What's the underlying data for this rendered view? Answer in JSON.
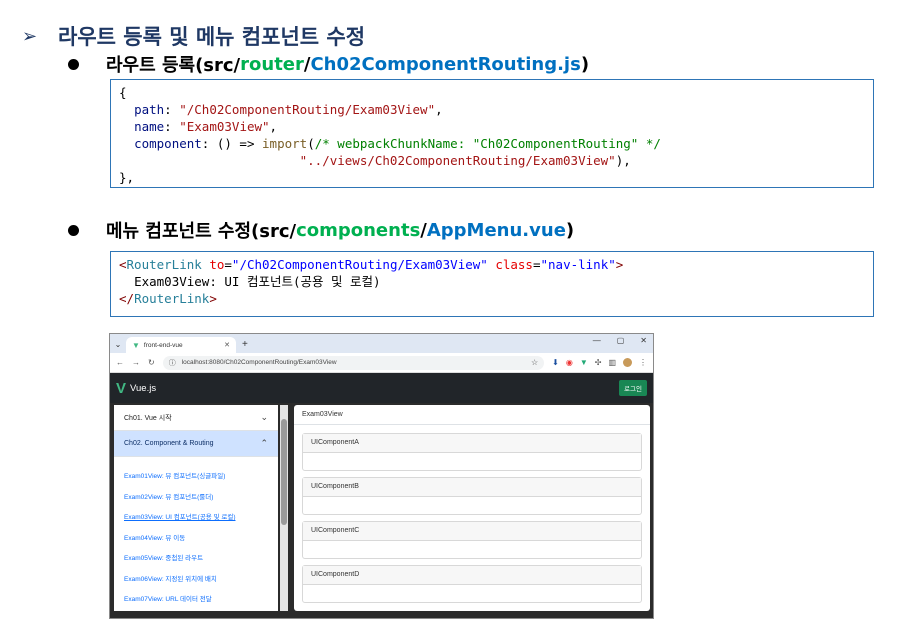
{
  "heading": {
    "arrow": "➢",
    "title": "라우트 등록 및 메뉴 컴포넌트 수정"
  },
  "bullet1": {
    "prefix": "라우트 등록(src/",
    "router": "router",
    "slash": "/",
    "file": "Ch02ComponentRouting.js",
    "suffix": ")"
  },
  "code1": {
    "open": "{",
    "path_key": "path",
    "path_val": "\"/Ch02ComponentRouting/Exam03View\"",
    "name_key": "name",
    "name_val": "\"Exam03View\"",
    "component_key": "component",
    "arrow": "() =>",
    "import_fn": "import",
    "comment": "/* webpackChunkName: \"Ch02ComponentRouting\" */",
    "import_path": "\"../views/Ch02ComponentRouting/Exam03View\"",
    "close": "},"
  },
  "bullet2": {
    "prefix": "메뉴 컴포넌트 수정(src/",
    "components": "components",
    "slash": "/",
    "file": "AppMenu.vue",
    "suffix": ")"
  },
  "code2": {
    "tag_open": "<",
    "tag_name": "RouterLink",
    "to_attr": "to",
    "to_val": "\"/Ch02ComponentRouting/Exam03View\"",
    "class_attr": "class",
    "class_val": "\"nav-link\"",
    "tag_end": ">",
    "text": "Exam03View: UI 컴포넌트(공용 및 로컬)",
    "close_open": "</",
    "close_name": "RouterLink",
    "close_end": ">"
  },
  "browser": {
    "tab_title": "front-end-vue",
    "url": "localhost:8080/Ch02ComponentRouting/Exam03View",
    "brand": "Vue.js",
    "login_label": "로그인",
    "accordion": [
      {
        "label": "Ch01. Vue 시작",
        "expanded": false
      },
      {
        "label": "Ch02. Component & Routing",
        "expanded": true
      }
    ],
    "links": [
      "Exam01View: 뷰 컴포넌트(싱글파일)",
      "Exam02View: 뷰 컴포넌트(룰더)",
      "Exam03View: UI 컴포넌트(공용 및 로컬)",
      "Exam04View: 뷰 이동",
      "Exam05View: 중첩된 라우트",
      "Exam06View: 지정된 위치에 배치",
      "Exam07View: URL 데이터 전달"
    ],
    "content_title": "Exam03View",
    "cards": [
      "UIComponentA",
      "UIComponentB",
      "UIComponentC",
      "UIComponentD"
    ]
  },
  "colors": {
    "heading": "#1f3864",
    "green": "#00b050",
    "blue": "#0070c0",
    "code_border": "#2e75b6",
    "vue_green": "#41b883",
    "login_green": "#198754"
  }
}
